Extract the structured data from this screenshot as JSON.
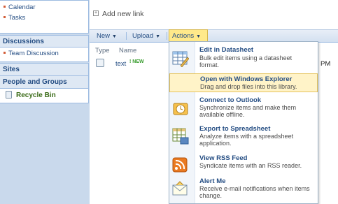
{
  "quick_launch": {
    "top_items": [
      "Calendar",
      "Tasks"
    ],
    "discussions_heading": "Discussions",
    "discussion_items": [
      "Team Discussion"
    ],
    "sites_heading": "Sites",
    "people_heading": "People and Groups",
    "recycle_bin": "Recycle Bin"
  },
  "main": {
    "add_link": "Add new link",
    "toolbar": {
      "new": "New",
      "upload": "Upload",
      "actions": "Actions"
    },
    "columns": {
      "type": "Type",
      "name": "Name"
    },
    "row": {
      "name": "text",
      "new_badge": "! NEW",
      "time_fragment": "PM"
    }
  },
  "actions_menu": {
    "items": [
      {
        "title": "Edit in Datasheet",
        "desc": "Bulk edit items using a datasheet format.",
        "icon": "datasheet-icon"
      },
      {
        "title": "Open with Windows Explorer",
        "desc": "Drag and drop files into this library.",
        "icon": "windows-explorer-icon"
      },
      {
        "title": "Connect to Outlook",
        "desc": "Synchronize items and make them available offline.",
        "icon": "outlook-icon"
      },
      {
        "title": "Export to Spreadsheet",
        "desc": "Analyze items with a spreadsheet application.",
        "icon": "spreadsheet-icon"
      },
      {
        "title": "View RSS Feed",
        "desc": "Syndicate items with an RSS reader.",
        "icon": "rss-icon"
      },
      {
        "title": "Alert Me",
        "desc": "Receive e-mail notifications when items change.",
        "icon": "alert-icon"
      }
    ]
  },
  "colors": {
    "nav_bg": "#c9d9ec",
    "link": "#244d83",
    "actions_highlight": "#ffe98a",
    "menu_highlight": "#fff3c8",
    "new_badge": "#359b2a"
  }
}
